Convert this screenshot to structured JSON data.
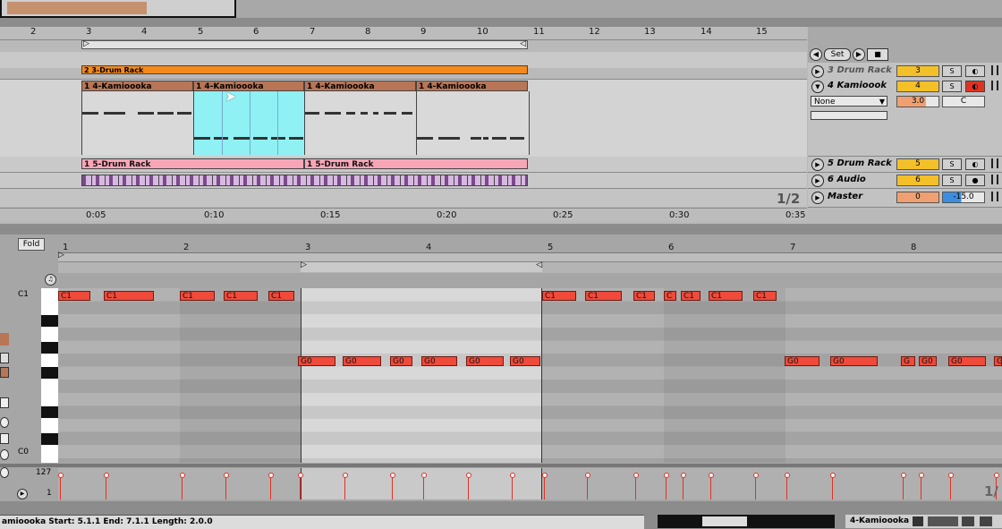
{
  "arrangement": {
    "bar_numbers": [
      "2",
      "3",
      "4",
      "5",
      "6",
      "7",
      "8",
      "9",
      "10",
      "11",
      "12",
      "13",
      "14",
      "15"
    ],
    "time_labels": [
      "0:05",
      "0:10",
      "0:15",
      "0:20",
      "0:25",
      "0:30",
      "0:35"
    ],
    "controls": {
      "set_label": "Set"
    },
    "clips": {
      "orange_clip": "2 3-Drum Rack",
      "kamiooka_1": "1 4-Kamioooka",
      "kamiooka_2": "1 4-Kamioooka",
      "kamiooka_3": "1 4-Kamioooka",
      "kamiooka_4": "1 4-Kamioooka",
      "drum_1": "1 5-Drum Rack",
      "drum_2": "1 5-Drum Rack"
    },
    "page_indicator": "1/2"
  },
  "mixer": {
    "tracks": [
      {
        "name": "3 Drum Rack",
        "number": "3",
        "solo": "S"
      },
      {
        "name": "4 Kamioook",
        "number": "4",
        "solo": "S",
        "input": "None",
        "value": "3.0",
        "key": "C"
      },
      {
        "name": "5 Drum Rack",
        "number": "5",
        "solo": "S"
      },
      {
        "name": "6 Audio",
        "number": "6",
        "solo": "S"
      },
      {
        "name": "Master",
        "number": "0",
        "volume": "-15.0"
      }
    ]
  },
  "piano_roll": {
    "fold_label": "Fold",
    "bar_numbers": [
      "1",
      "2",
      "3",
      "4",
      "5",
      "6",
      "7",
      "8"
    ],
    "key_labels": {
      "top": "C1",
      "bottom": "C0"
    },
    "velocity_labels": {
      "max": "127",
      "min": "1"
    },
    "note_c1": "C1",
    "note_g0": "G0",
    "note_g_short": "G"
  },
  "status_bar": {
    "clip_info": "amioooka  Start: 5.1.1  End: 7.1.1  Length: 2.0.0",
    "right_label": "4-Kamioooka"
  },
  "colors": {
    "clip_brown": "#b87656",
    "drum_pink": "#f7a6b7",
    "note_red": "#f04a3a",
    "selection_cyan": "#8ff1f4",
    "track_yellow": "#f3c02a"
  }
}
